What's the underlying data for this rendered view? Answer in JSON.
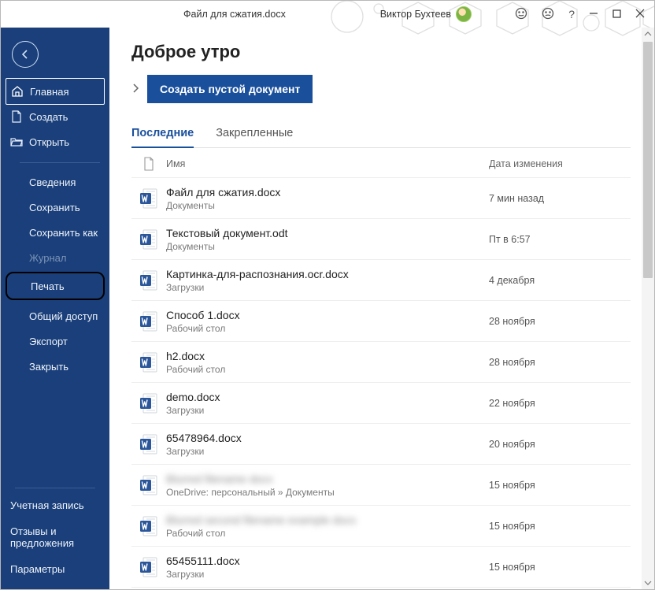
{
  "titlebar": {
    "filename": "Файл для сжатия.docx",
    "username": "Виктор Бухтеев"
  },
  "sidebar": {
    "items": [
      {
        "label": "Главная",
        "kind": "home",
        "active": true
      },
      {
        "label": "Создать",
        "kind": "new"
      },
      {
        "label": "Открыть",
        "kind": "open"
      }
    ],
    "secondary": [
      {
        "label": "Сведения"
      },
      {
        "label": "Сохранить"
      },
      {
        "label": "Сохранить как"
      },
      {
        "label": "Журнал",
        "disabled": true
      },
      {
        "label": "Печать",
        "highlight": true
      },
      {
        "label": "Общий доступ"
      },
      {
        "label": "Экспорт"
      },
      {
        "label": "Закрыть"
      }
    ],
    "bottom": [
      {
        "label": "Учетная запись"
      },
      {
        "label": "Отзывы и предложения"
      },
      {
        "label": "Параметры"
      }
    ]
  },
  "main": {
    "greeting": "Доброе утро",
    "create_button": "Создать пустой документ",
    "tabs": {
      "recent": "Последние",
      "pinned": "Закрепленные"
    },
    "columns": {
      "name": "Имя",
      "date": "Дата изменения"
    },
    "files": [
      {
        "name": "Файл для сжатия.docx",
        "location": "Документы",
        "date": "7 мин назад"
      },
      {
        "name": "Текстовый документ.odt",
        "location": "Документы",
        "date": "Пт в 6:57"
      },
      {
        "name": "Картинка-для-распознания.ocr.docx",
        "location": "Загрузки",
        "date": "4 декабря"
      },
      {
        "name": "Способ 1.docx",
        "location": "Рабочий стол",
        "date": "28 ноября"
      },
      {
        "name": "h2.docx",
        "location": "Рабочий стол",
        "date": "28 ноября"
      },
      {
        "name": "demo.docx",
        "location": "Загрузки",
        "date": "22 ноября"
      },
      {
        "name": "65478964.docx",
        "location": "Загрузки",
        "date": "20 ноября"
      },
      {
        "name": "Blurred filename docx",
        "location": "OneDrive: персональный » Документы",
        "date": "15 ноября",
        "blur": true
      },
      {
        "name": "Blurred second filename example docx",
        "location": "Рабочий стол",
        "date": "15 ноября",
        "blur": true
      },
      {
        "name": "65455111.docx",
        "location": "Загрузки",
        "date": "15 ноября"
      }
    ]
  },
  "icons": {
    "page_header": "page-icon"
  }
}
